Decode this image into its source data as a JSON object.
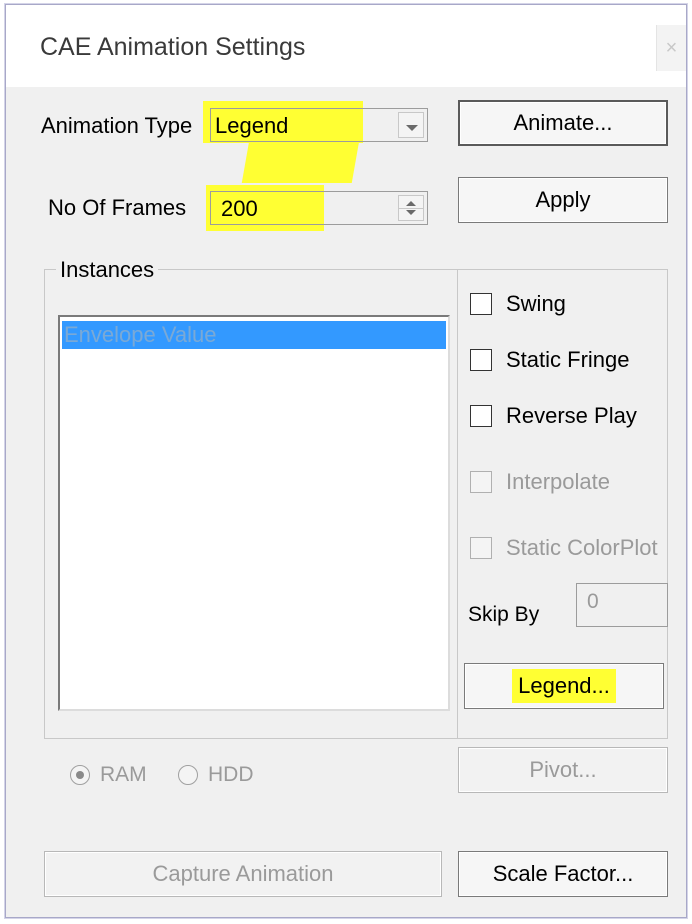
{
  "window": {
    "title": "CAE Animation Settings",
    "close_glyph": "×"
  },
  "animation_type": {
    "label": "Animation Type",
    "value": "Legend"
  },
  "frames": {
    "label": "No Of Frames",
    "value": "200"
  },
  "buttons": {
    "animate": "Animate...",
    "apply": "Apply",
    "legend": "Legend...",
    "pivot": "Pivot...",
    "capture": "Capture Animation",
    "scale_factor": "Scale Factor..."
  },
  "instances": {
    "title": "Instances",
    "items": [
      "Envelope Value"
    ]
  },
  "options": {
    "swing": "Swing",
    "static_fringe": "Static Fringe",
    "reverse_play": "Reverse Play",
    "interpolate": "Interpolate",
    "static_colorplot": "Static ColorPlot",
    "skip_by_label": "Skip By",
    "skip_by_value": "0"
  },
  "storage": {
    "ram": "RAM",
    "hdd": "HDD",
    "selected": "RAM"
  },
  "colors": {
    "highlight": "#ffff33",
    "selection": "#3399ff",
    "dialog_bg": "#f0f0f0"
  }
}
